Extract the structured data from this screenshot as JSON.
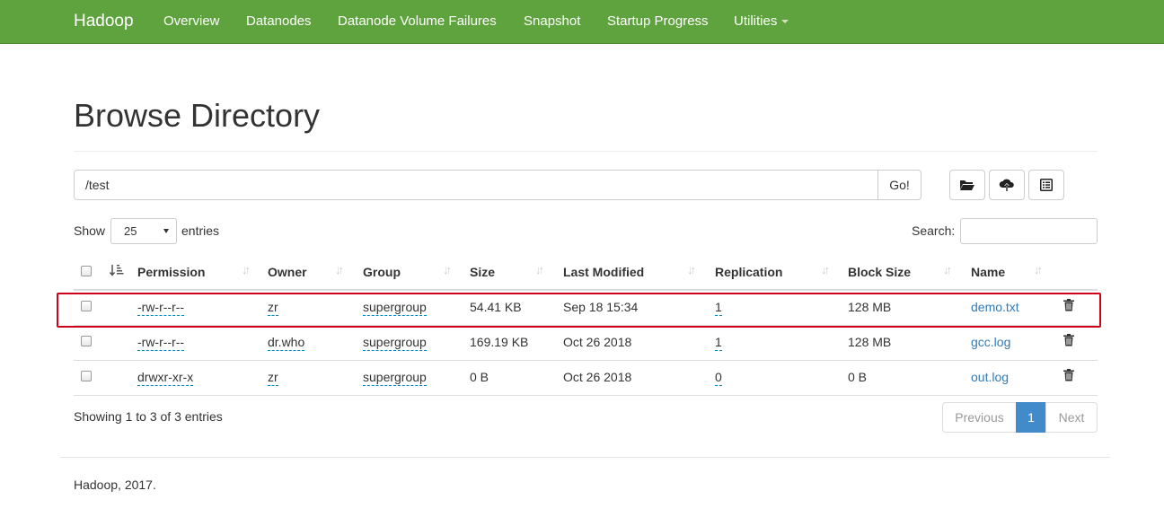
{
  "navbar": {
    "brand": "Hadoop",
    "items": [
      "Overview",
      "Datanodes",
      "Datanode Volume Failures",
      "Snapshot",
      "Startup Progress",
      "Utilities"
    ],
    "color": "#5fa33e"
  },
  "page": {
    "title": "Browse Directory"
  },
  "path_bar": {
    "value": "/test",
    "go_label": "Go!"
  },
  "toolbar": {
    "icons": [
      "folder-open-icon",
      "cloud-upload-icon",
      "list-alt-icon"
    ]
  },
  "table_controls": {
    "show_label": "Show",
    "page_size": "25",
    "entries_label": "entries",
    "search_label": "Search:"
  },
  "table": {
    "columns": [
      "Permission",
      "Owner",
      "Group",
      "Size",
      "Last Modified",
      "Replication",
      "Block Size",
      "Name"
    ],
    "rows": [
      {
        "permission": "-rw-r--r--",
        "owner": "zr",
        "group": "supergroup",
        "size": "54.41 KB",
        "modified": "Sep 18 15:34",
        "replication": "1",
        "block_size": "128 MB",
        "name": "demo.txt"
      },
      {
        "permission": "-rw-r--r--",
        "owner": "dr.who",
        "group": "supergroup",
        "size": "169.19 KB",
        "modified": "Oct 26 2018",
        "replication": "1",
        "block_size": "128 MB",
        "name": "gcc.log"
      },
      {
        "permission": "drwxr-xr-x",
        "owner": "zr",
        "group": "supergroup",
        "size": "0 B",
        "modified": "Oct 26 2018",
        "replication": "0",
        "block_size": "0 B",
        "name": "out.log"
      }
    ],
    "highlight_color": "#d0021b"
  },
  "pagination": {
    "info": "Showing 1 to 3 of 3 entries",
    "previous": "Previous",
    "current": "1",
    "next": "Next"
  },
  "footer": {
    "text": "Hadoop, 2017."
  }
}
